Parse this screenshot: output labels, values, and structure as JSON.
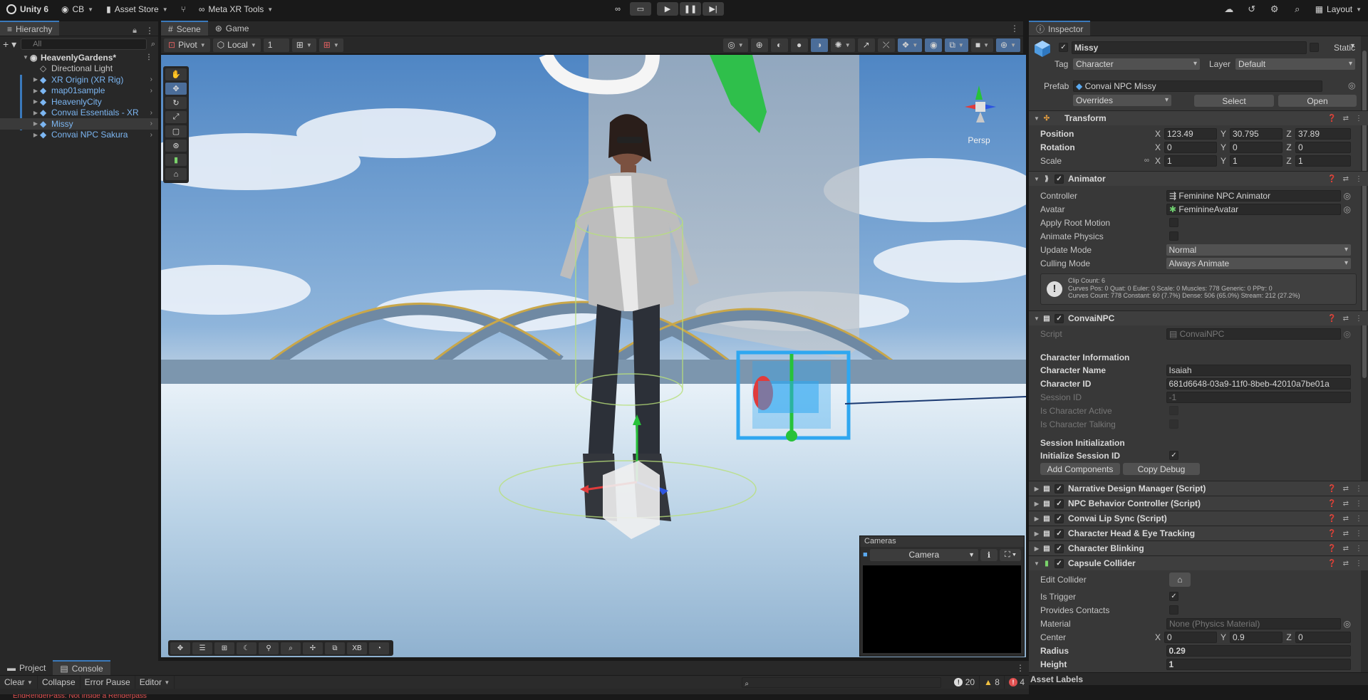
{
  "topbar": {
    "app": "Unity 6",
    "account": "CB",
    "asset_store": "Asset Store",
    "meta_xr": "Meta XR Tools",
    "layout": "Layout"
  },
  "hierarchy": {
    "tab": "Hierarchy",
    "search_placeholder": "All",
    "scene": "HeavenlyGardens*",
    "items": [
      {
        "label": "Directional Light"
      },
      {
        "label": "XR Origin (XR Rig)"
      },
      {
        "label": "map01sample"
      },
      {
        "label": "HeavenlyCity"
      },
      {
        "label": "Convai Essentials - XR"
      },
      {
        "label": "Missy"
      },
      {
        "label": "Convai NPC Sakura"
      }
    ]
  },
  "scene": {
    "tab_scene": "Scene",
    "tab_game": "Game",
    "pivot": "Pivot",
    "local": "Local",
    "grid_value": "1",
    "gizmo_label": "Persp",
    "xb_label": "XB"
  },
  "cameras": {
    "title": "Cameras",
    "selected": "Camera"
  },
  "inspector": {
    "tab": "Inspector",
    "object_name": "Missy",
    "static_label": "Static",
    "tag_label": "Tag",
    "tag_value": "Character",
    "layer_label": "Layer",
    "layer_value": "Default",
    "prefab_label": "Prefab",
    "prefab_value": "Convai NPC Missy",
    "overrides": "Overrides",
    "select": "Select",
    "open": "Open",
    "transform": {
      "title": "Transform",
      "position_label": "Position",
      "rotation_label": "Rotation",
      "scale_label": "Scale",
      "position": {
        "x": "123.49",
        "y": "30.795",
        "z": "37.89"
      },
      "rotation": {
        "x": "0",
        "y": "0",
        "z": "0"
      },
      "scale": {
        "x": "1",
        "y": "1",
        "z": "1"
      }
    },
    "animator": {
      "title": "Animator",
      "controller_label": "Controller",
      "controller_value": "Feminine NPC Animator",
      "avatar_label": "Avatar",
      "avatar_value": "FeminineAvatar",
      "apply_root_motion": "Apply Root Motion",
      "animate_physics": "Animate Physics",
      "update_mode_label": "Update Mode",
      "update_mode_value": "Normal",
      "culling_mode_label": "Culling Mode",
      "culling_mode_value": "Always Animate",
      "info_line1": "Clip Count: 6",
      "info_line2": "Curves Pos: 0 Quat: 0 Euler: 0 Scale: 0 Muscles: 778 Generic: 0 PPtr: 0",
      "info_line3": "Curves Count: 778 Constant: 60 (7.7%) Dense: 506 (65.0%) Stream: 212 (27.2%)"
    },
    "convai_npc": {
      "title": "ConvaiNPC",
      "script_label": "Script",
      "script_value": "ConvaiNPC",
      "char_info_header": "Character Information",
      "char_name_label": "Character Name",
      "char_name_value": "Isaiah",
      "char_id_label": "Character ID",
      "char_id_value": "681d6648-03a9-11f0-8beb-42010a7be01a",
      "session_id_label": "Session ID",
      "session_id_value": "-1",
      "is_active_label": "Is Character Active",
      "is_talking_label": "Is Character Talking",
      "session_init_header": "Session Initialization",
      "init_session_label": "Initialize Session ID",
      "add_components": "Add Components",
      "copy_debug": "Copy Debug"
    },
    "components": [
      {
        "title": "Narrative Design Manager (Script)"
      },
      {
        "title": "NPC Behavior Controller (Script)"
      },
      {
        "title": "Convai Lip Sync (Script)"
      },
      {
        "title": "Character Head & Eye Tracking"
      },
      {
        "title": "Character Blinking"
      }
    ],
    "capsule": {
      "title": "Capsule Collider",
      "edit_collider": "Edit Collider",
      "is_trigger": "Is Trigger",
      "provides_contacts": "Provides Contacts",
      "material_label": "Material",
      "material_value": "None (Physics Material)",
      "center_label": "Center",
      "center": {
        "x": "0",
        "y": "0.9",
        "z": "0"
      },
      "radius_label": "Radius",
      "radius_value": "0.29",
      "height_label": "Height",
      "height_value": "1"
    },
    "asset_labels": "Asset Labels"
  },
  "console": {
    "tab_project": "Project",
    "tab_console": "Console",
    "clear": "Clear",
    "collapse": "Collapse",
    "error_pause": "Error Pause",
    "editor": "Editor",
    "count_info": "20",
    "count_warn": "8",
    "count_error": "4"
  },
  "status": {
    "message": "EndRenderPass: Not inside a Renderpass"
  },
  "colors": {
    "accent": "#3a79bb",
    "prefab_blue": "#7cb6f2",
    "panel": "#383838",
    "dark": "#191919"
  }
}
